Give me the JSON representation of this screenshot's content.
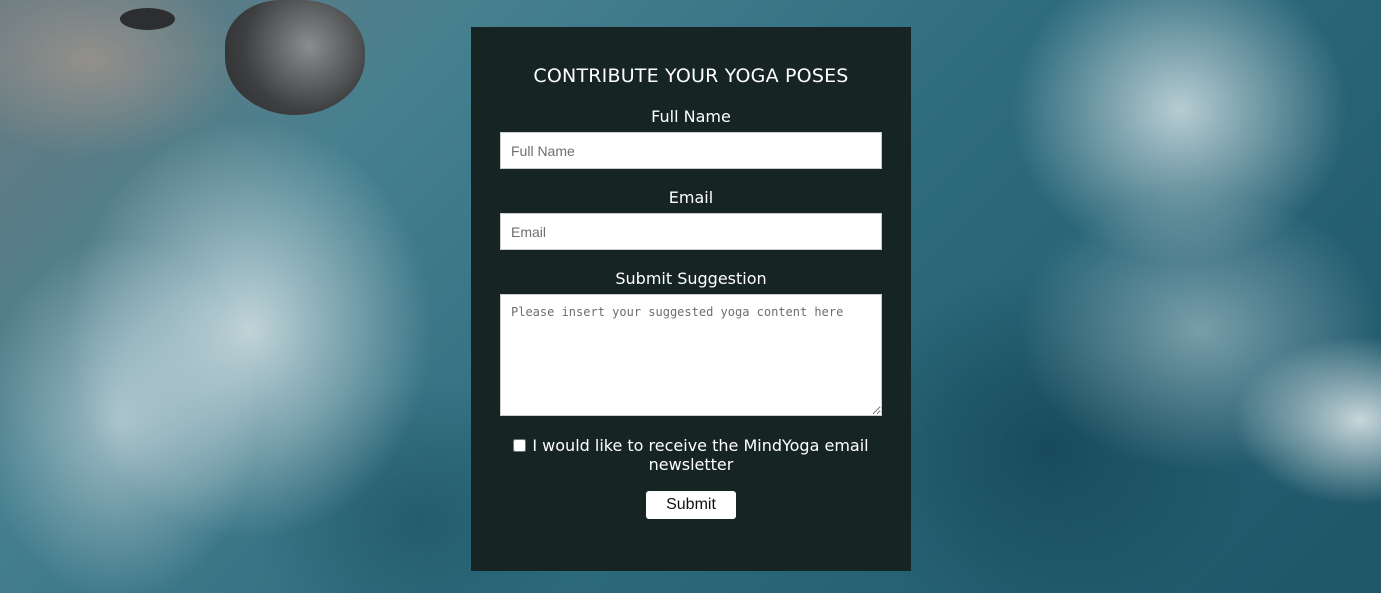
{
  "form": {
    "title": "CONTRIBUTE YOUR YOGA POSES",
    "full_name": {
      "label": "Full Name",
      "placeholder": "Full Name",
      "value": ""
    },
    "email": {
      "label": "Email",
      "placeholder": "Email",
      "value": ""
    },
    "suggestion": {
      "label": "Submit Suggestion",
      "placeholder": "Please insert your suggested yoga content here",
      "value": ""
    },
    "newsletter": {
      "label": "I would like to receive the MindYoga email newsletter",
      "checked": false
    },
    "submit_label": "Submit"
  },
  "colors": {
    "card_background": "#162424",
    "text": "#ffffff",
    "input_background": "#ffffff"
  }
}
